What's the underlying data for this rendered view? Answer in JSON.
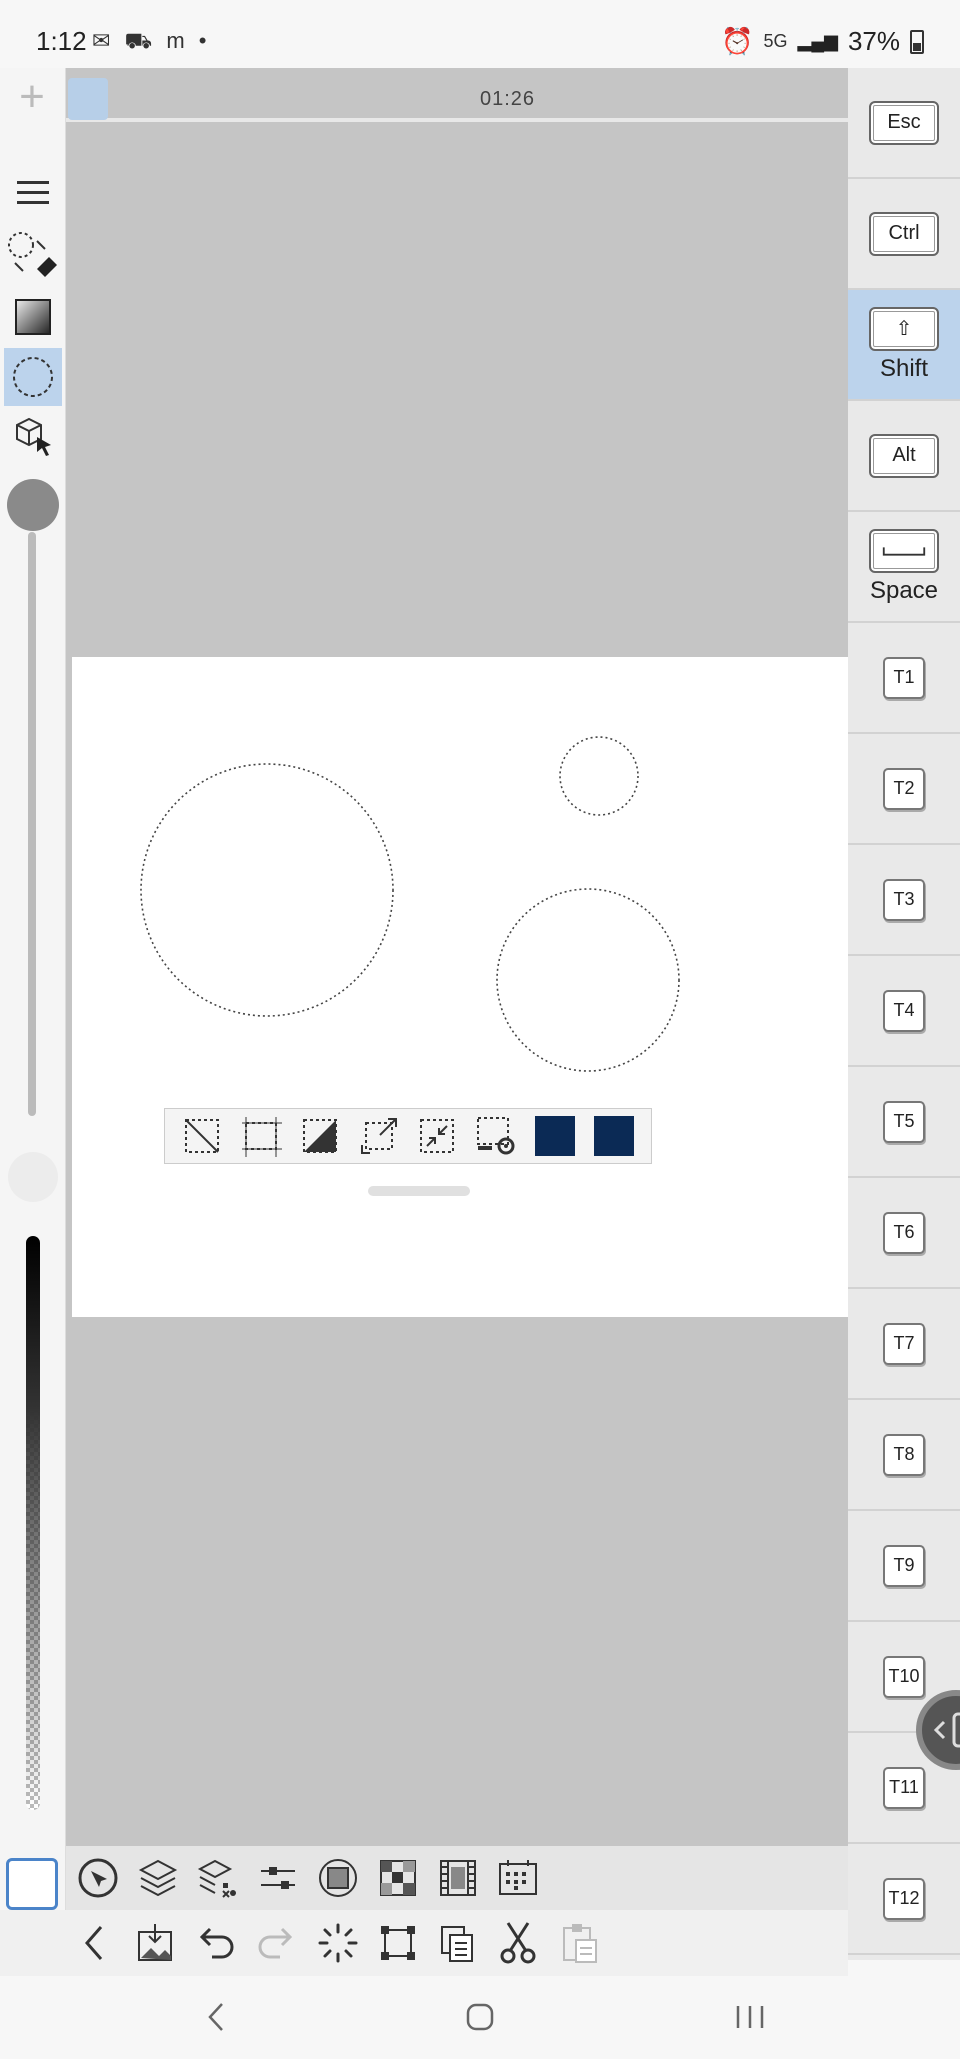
{
  "status_bar": {
    "time": "1:12",
    "notifications": "✉ ⛟ m •",
    "network": "5G",
    "battery": "37%"
  },
  "timeline": {
    "time": "01:26"
  },
  "keys": {
    "esc": "Esc",
    "ctrl": "Ctrl",
    "shift_label": "Shift",
    "alt": "Alt",
    "space_label": "Space",
    "t_keys": [
      "T1",
      "T2",
      "T3",
      "T4",
      "T5",
      "T6",
      "T7",
      "T8",
      "T9",
      "T10",
      "T11",
      "T12"
    ]
  },
  "colors": {
    "selection_fill": "#0b2a55",
    "active_key": "#bcd3ec",
    "canvas_bg": "#c5c5c5"
  },
  "icons": {
    "left_toolbar": [
      "menu-icon",
      "selection-eraser-icon",
      "gradient-icon",
      "ellipse-selection-icon",
      "3d-object-select-icon",
      "brush-size-icon"
    ],
    "selection_toolbar": [
      "deselect-icon",
      "select-all-icon",
      "invert-selection-icon",
      "expand-selection-icon",
      "shrink-selection-icon",
      "selection-settings-icon",
      "fill-swatch-icon",
      "fill-swatch-icon"
    ],
    "bottom_row1": [
      "select-layer-icon",
      "layers-icon",
      "layer-properties-icon",
      "adjust-icon",
      "mask-icon",
      "palette-grid-icon",
      "film-icon",
      "frame-grid-icon"
    ],
    "bottom_row2": [
      "back-icon",
      "export-icon",
      "undo-icon",
      "redo-icon",
      "loading-icon",
      "transform-icon",
      "copy-icon",
      "cut-icon",
      "paste-icon"
    ]
  }
}
